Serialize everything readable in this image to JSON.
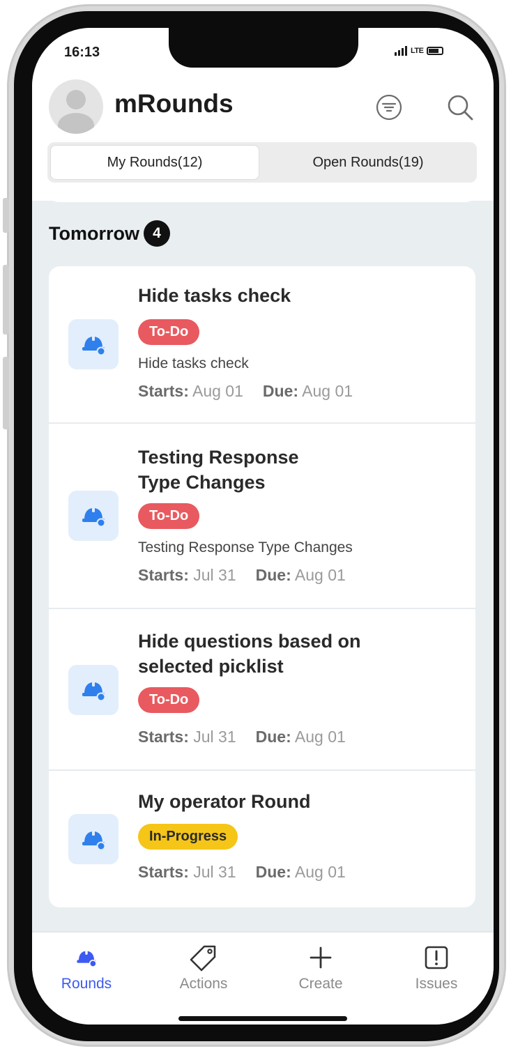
{
  "status_bar": {
    "time": "16:13",
    "network": "LTE"
  },
  "header": {
    "title": "mRounds",
    "avatar_icon": "user-avatar-icon",
    "filter_icon": "filter-icon",
    "search_icon": "search-icon"
  },
  "tabs": [
    {
      "label": "My Rounds(12)",
      "active": true
    },
    {
      "label": "Open Rounds(19)",
      "active": false
    }
  ],
  "section": {
    "title": "Tomorrow",
    "count": "4"
  },
  "rounds": [
    {
      "title": "Hide tasks check",
      "status": "To-Do",
      "description": "Hide tasks check",
      "starts_label": "Starts:",
      "starts": "Aug 01",
      "due_label": "Due:",
      "due": "Aug 01"
    },
    {
      "title": "Testing Response Type Changes",
      "status": "To-Do",
      "description": "Testing Response Type Changes",
      "starts_label": "Starts:",
      "starts": "Jul 31",
      "due_label": "Due:",
      "due": "Aug 01"
    },
    {
      "title": "Hide questions based on selected picklist",
      "status": "To-Do",
      "description": "",
      "starts_label": "Starts:",
      "starts": "Jul 31",
      "due_label": "Due:",
      "due": "Aug 01"
    },
    {
      "title": "My operator Round",
      "status": "In-Progress",
      "description": "",
      "starts_label": "Starts:",
      "starts": "Jul 31",
      "due_label": "Due:",
      "due": "Aug 01"
    }
  ],
  "bottom_nav": [
    {
      "label": "Rounds",
      "icon": "hard-hat-icon",
      "active": true
    },
    {
      "label": "Actions",
      "icon": "tag-icon",
      "active": false
    },
    {
      "label": "Create",
      "icon": "plus-icon",
      "active": false
    },
    {
      "label": "Issues",
      "icon": "alert-square-icon",
      "active": false
    }
  ],
  "colors": {
    "accent": "#3d5af1",
    "todo": "#e85a5f",
    "in_progress": "#f5c518",
    "icon_blue": "#2f80ed",
    "background": "#e9eef1"
  }
}
